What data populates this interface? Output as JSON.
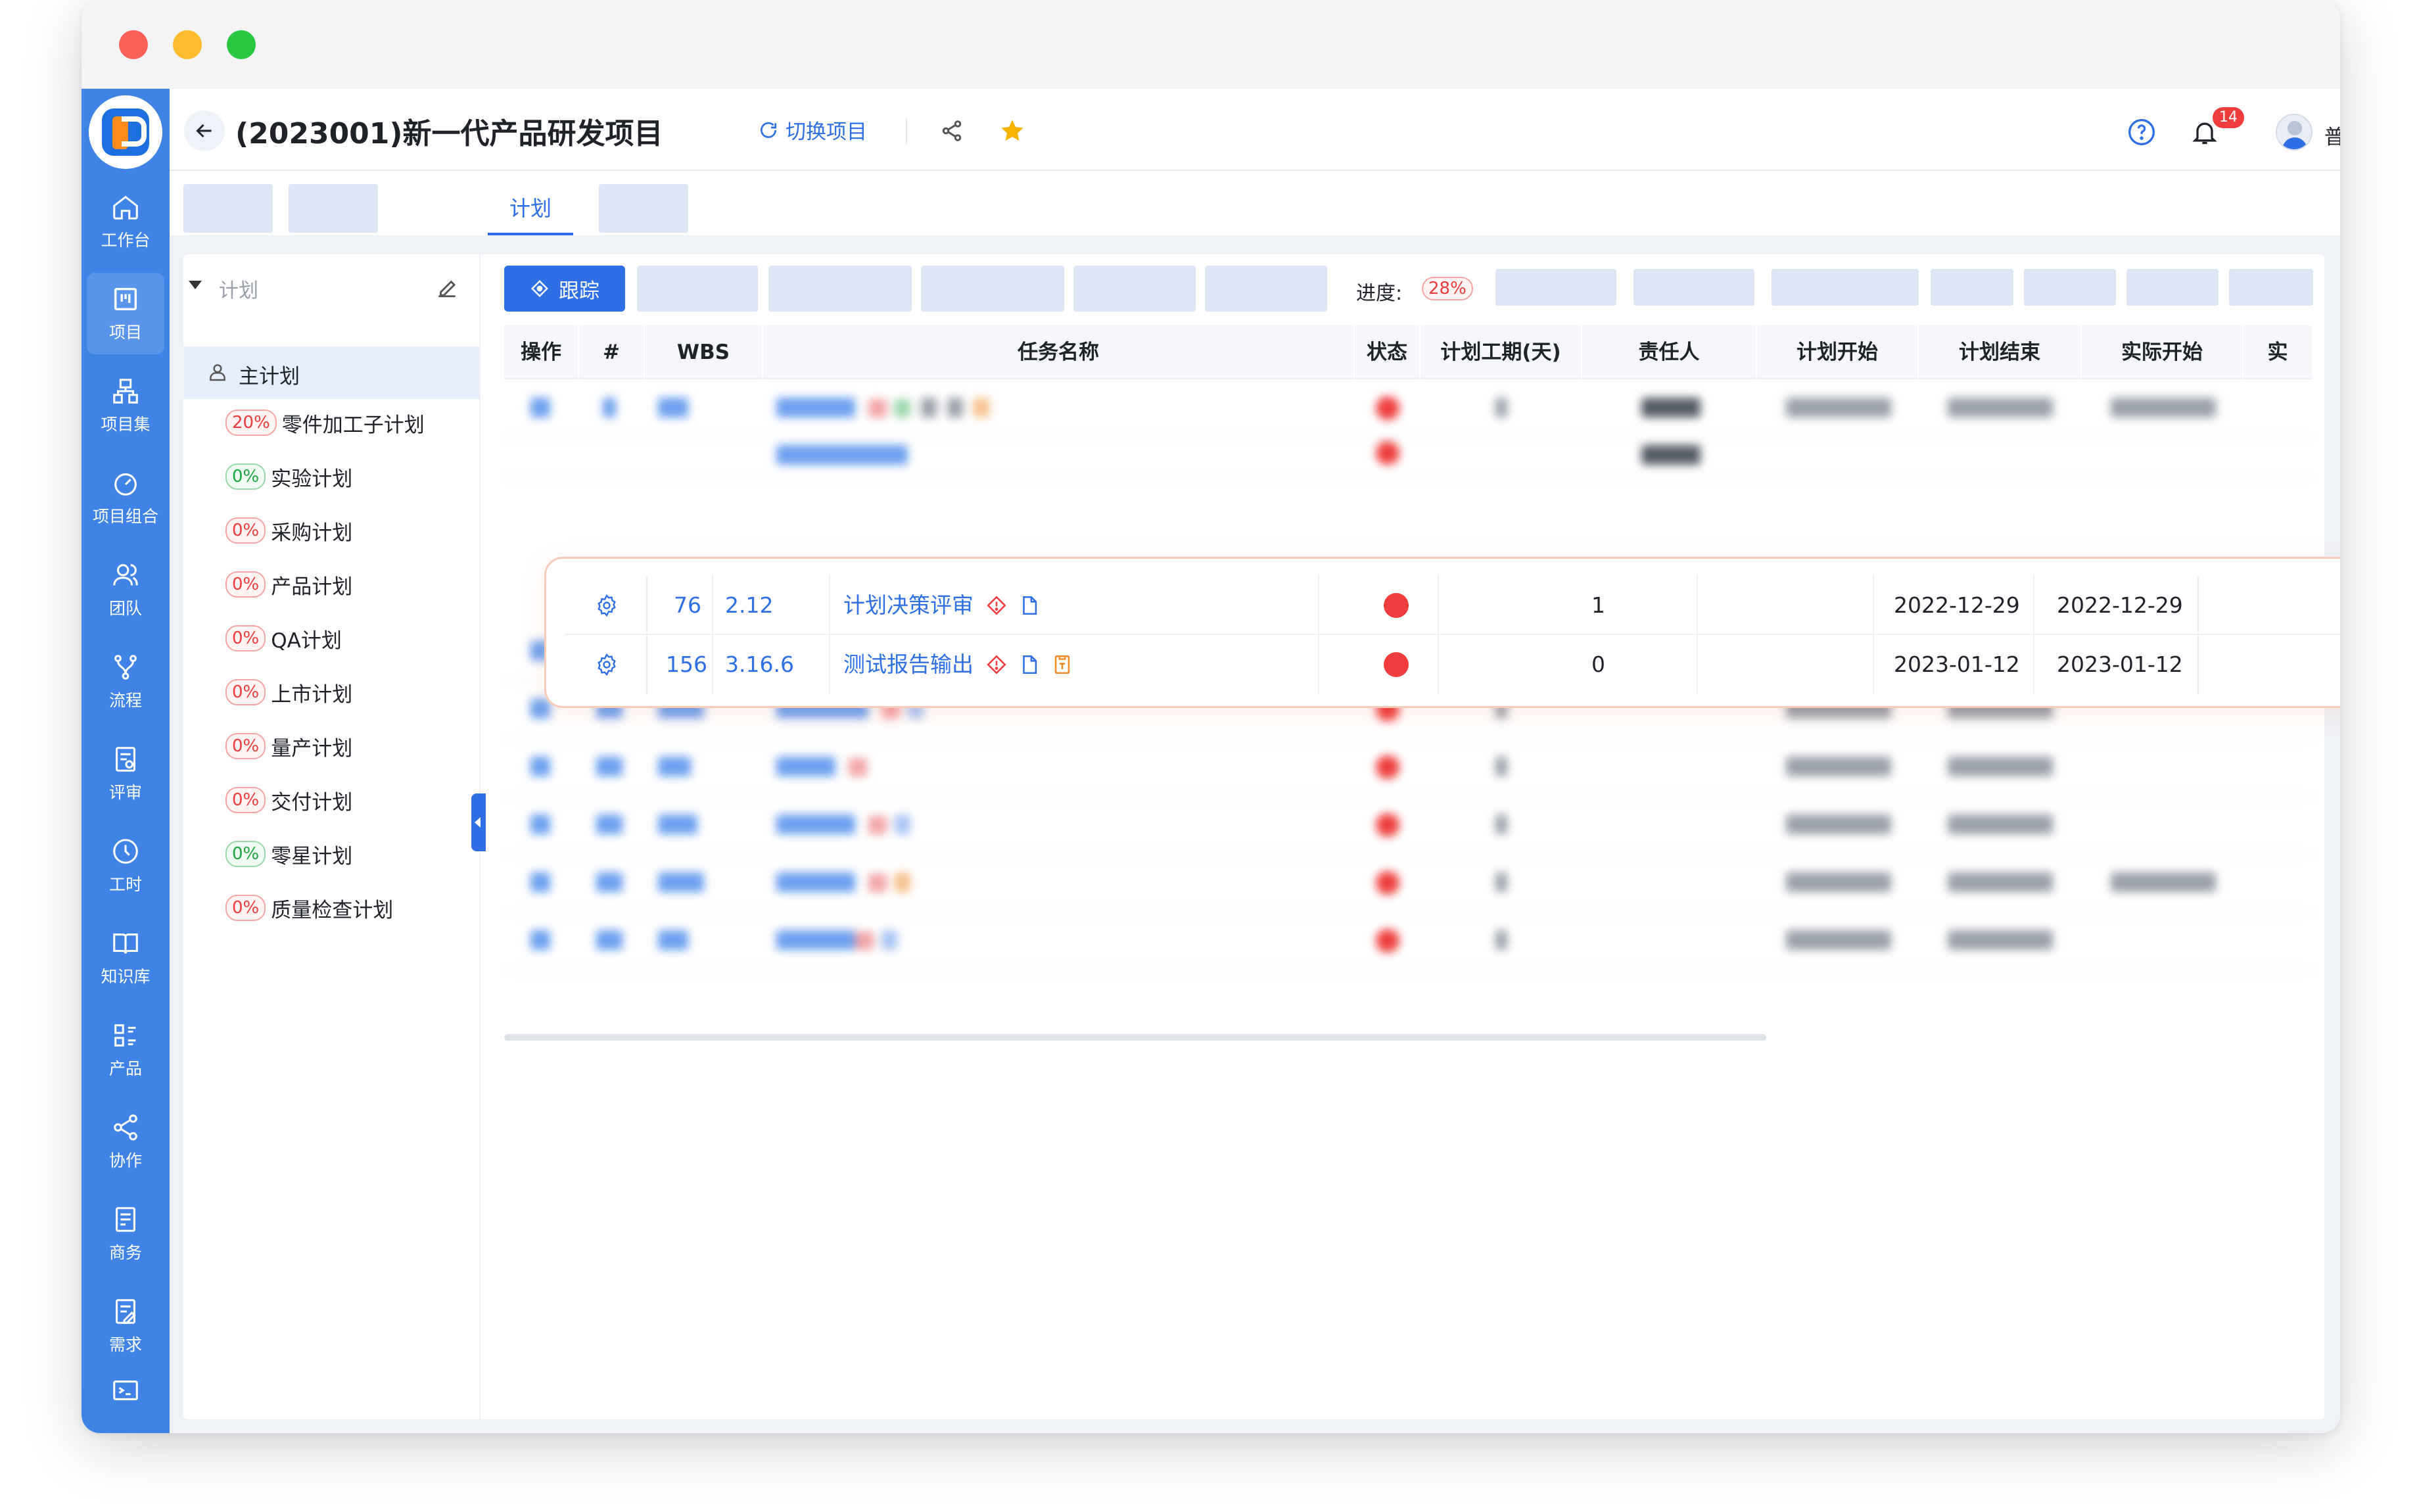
{
  "nav": {
    "items": [
      {
        "label": "工作台",
        "icon": "home-icon"
      },
      {
        "label": "项目",
        "icon": "project-board-icon"
      },
      {
        "label": "项目集",
        "icon": "project-set-icon"
      },
      {
        "label": "项目组合",
        "icon": "dashboard-icon"
      },
      {
        "label": "团队",
        "icon": "team-icon"
      },
      {
        "label": "流程",
        "icon": "flow-icon"
      },
      {
        "label": "评审",
        "icon": "review-icon"
      },
      {
        "label": "工时",
        "icon": "clock-icon"
      },
      {
        "label": "知识库",
        "icon": "book-icon"
      },
      {
        "label": "产品",
        "icon": "product-icon"
      },
      {
        "label": "协作",
        "icon": "share-icon"
      },
      {
        "label": "商务",
        "icon": "business-icon"
      },
      {
        "label": "需求",
        "icon": "requirement-icon"
      }
    ],
    "active_index": 1
  },
  "header": {
    "project_title": "(2023001)新一代产品研发项目",
    "switch_project": "切换项目",
    "notification_count": "14",
    "user_name": "普明"
  },
  "tabs": {
    "active_label": "计划"
  },
  "tree": {
    "title": "计划",
    "main_plan": "主计划",
    "items": [
      {
        "pct": "20%",
        "label": "零件加工子计划",
        "status": "red"
      },
      {
        "pct": "0%",
        "label": "实验计划",
        "status": "green"
      },
      {
        "pct": "0%",
        "label": "采购计划",
        "status": "red"
      },
      {
        "pct": "0%",
        "label": "产品计划",
        "status": "red"
      },
      {
        "pct": "0%",
        "label": "QA计划",
        "status": "red"
      },
      {
        "pct": "0%",
        "label": "上市计划",
        "status": "red"
      },
      {
        "pct": "0%",
        "label": "量产计划",
        "status": "red"
      },
      {
        "pct": "0%",
        "label": "交付计划",
        "status": "red"
      },
      {
        "pct": "0%",
        "label": "零星计划",
        "status": "green"
      },
      {
        "pct": "0%",
        "label": "质量检查计划",
        "status": "red"
      }
    ]
  },
  "toolbar": {
    "track_label": "跟踪",
    "progress_label": "进度:",
    "progress_value": "28%"
  },
  "table": {
    "columns": [
      "操作",
      "#",
      "WBS",
      "任务名称",
      "状态",
      "计划工期(天)",
      "责任人",
      "计划开始",
      "计划结束",
      "实际开始",
      "实"
    ],
    "highlighted_rows": [
      {
        "id": "76",
        "wbs": "2.12",
        "name": "计划决策评审",
        "duration": "1",
        "plan_start": "2022-12-29",
        "plan_end": "2022-12-29"
      },
      {
        "id": "156",
        "wbs": "3.16.6",
        "name": "测试报告输出",
        "duration": "0",
        "plan_start": "2023-01-12",
        "plan_end": "2023-01-12"
      }
    ]
  },
  "colors": {
    "primary": "#2f6fe6",
    "nav_bg": "#3f83e6",
    "danger": "#f03c3c",
    "success": "#1fa53f",
    "star": "#f5b400"
  }
}
